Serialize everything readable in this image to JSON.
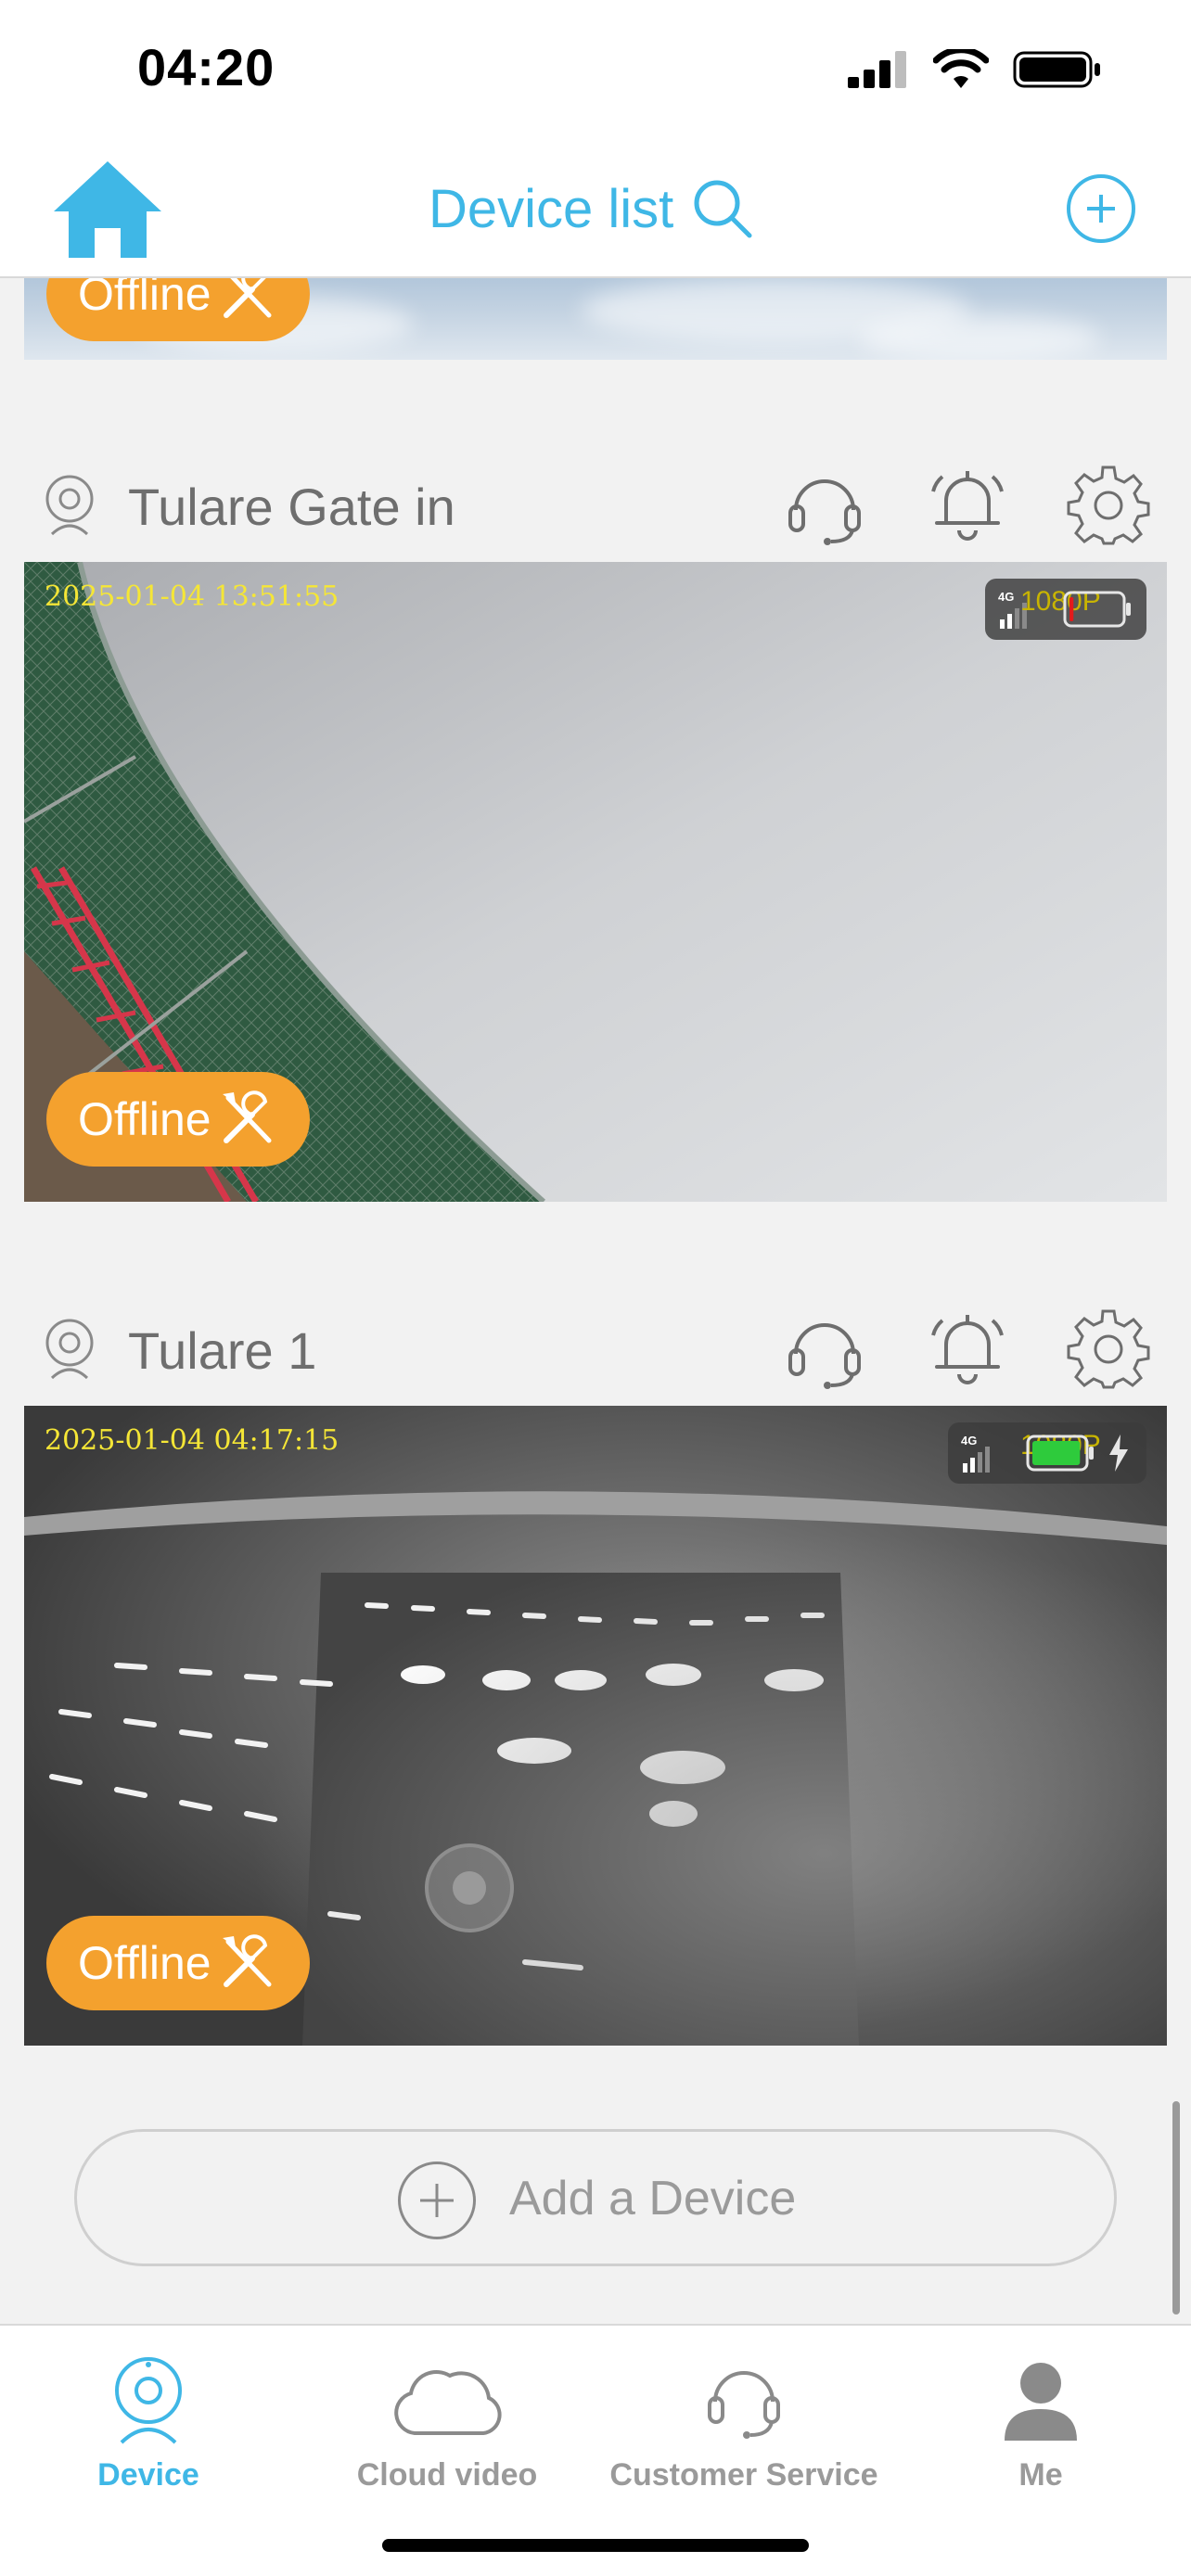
{
  "status_bar": {
    "time": "04:20"
  },
  "nav": {
    "title": "Device list"
  },
  "offline_label": "Offline",
  "devices": [
    {
      "name": "Tulare Gate in",
      "timestamp": "2025-01-04 13:51:55",
      "resolution": "1080P",
      "network": "4G",
      "battery_level": 0.08
    },
    {
      "name": "Tulare 1",
      "timestamp": "2025-01-04 04:17:15",
      "resolution": "1080P",
      "network": "4G",
      "battery_level": 0.95,
      "charging": true
    }
  ],
  "add_device": {
    "label": "Add a Device"
  },
  "tabs": [
    {
      "label": "Device",
      "icon": "camera-icon",
      "active": true
    },
    {
      "label": "Cloud video",
      "icon": "cloud-icon",
      "active": false
    },
    {
      "label": "Customer Service",
      "icon": "headset-icon",
      "active": false
    },
    {
      "label": "Me",
      "icon": "person-icon",
      "active": false
    }
  ],
  "colors": {
    "accent": "#3fb7e6",
    "offline": "#f4a12e",
    "timestamp": "#f5e636"
  }
}
